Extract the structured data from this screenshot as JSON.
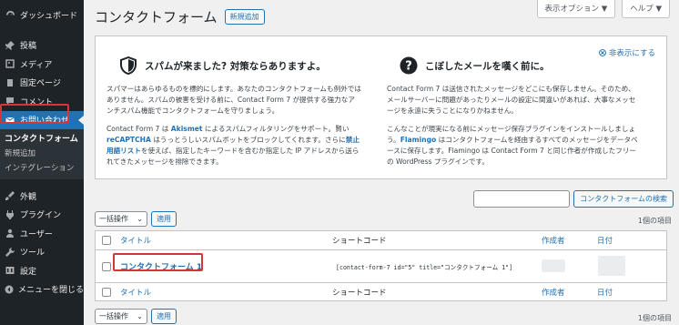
{
  "sidebar": {
    "dashboard": "ダッシュボード",
    "items": [
      {
        "label": "投稿",
        "icon": "pin-icon"
      },
      {
        "label": "メディア",
        "icon": "media-icon"
      },
      {
        "label": "固定ページ",
        "icon": "page-icon"
      },
      {
        "label": "コメント",
        "icon": "comment-icon"
      },
      {
        "label": "お問い合わせ",
        "icon": "mail-icon"
      }
    ],
    "submenu": [
      "コンタクトフォーム",
      "新規追加",
      "インテグレーション"
    ],
    "items2": [
      {
        "label": "外観",
        "icon": "brush-icon"
      },
      {
        "label": "プラグイン",
        "icon": "plugin-icon"
      },
      {
        "label": "ユーザー",
        "icon": "user-icon"
      },
      {
        "label": "ツール",
        "icon": "wrench-icon"
      },
      {
        "label": "設定",
        "icon": "settings-icon"
      },
      {
        "label": "メニューを閉じる",
        "icon": "collapse-icon"
      }
    ]
  },
  "header": {
    "title": "コンタクトフォーム",
    "add_new": "新規追加",
    "screen_options": "表示オプション ▼",
    "help": "ヘルプ ▼"
  },
  "welcome": {
    "dismiss": "非表示にする",
    "spam": {
      "title": "スパムが来ました? 対策ならありますよ。",
      "p1": "スパマーはあらゆるものを標的にします。あなたのコンタクトフォームも例外ではありません。スパムの被害を受ける前に、Contact Form 7 が提供する強力なアンチスパム機能でコンタクトフォームを守りましょう。",
      "p2_pre": "Contact Form 7 は ",
      "p2_link1": "Akismet",
      "p2_mid1": " によるスパムフィルタリングをサポート。賢い ",
      "p2_link2": "reCAPTCHA",
      "p2_mid2": " はうっとうしいスパムボットをブロックしてくれます。さらに",
      "p2_link3": "禁止用語リスト",
      "p2_post": "を使えば、指定したキーワードを含むか指定した IP アドレスから送られてきたメッセージを排除できます。"
    },
    "save": {
      "title": "こぼしたメールを嘆く前に。",
      "p1": "Contact Form 7 は送信されたメッセージをどこにも保存しません。そのため、メールサーバーに問題があったりメールの設定に間違いがあれば、大事なメッセージを永遠に失うことになりかねません。",
      "p2_pre": "こんなことが現実になる前にメッセージ保存プラグインをインストールしましょう。",
      "p2_link": "Flamingo",
      "p2_post": " はコンタクトフォームを経由するすべてのメッセージをデータベースに保存します。Flamingo は Contact Form 7 と同じ作者が作成したフリーの WordPress プラグインです。"
    }
  },
  "search": {
    "button": "コンタクトフォームの検索"
  },
  "tablenav": {
    "bulk": "一括操作",
    "apply": "適用",
    "count": "1個の項目"
  },
  "table": {
    "columns": {
      "title": "タイトル",
      "shortcode": "ショートコード",
      "author": "作成者",
      "date": "日付"
    },
    "rows": [
      {
        "title": "コンタクトフォーム 1",
        "shortcode": "[contact-form-7 id=\"5\" title=\"コンタクトフォーム 1\"]"
      }
    ]
  },
  "colors": {
    "sidebar_bg": "#1d2327",
    "accent": "#2271b1",
    "highlight": "#d63638"
  }
}
